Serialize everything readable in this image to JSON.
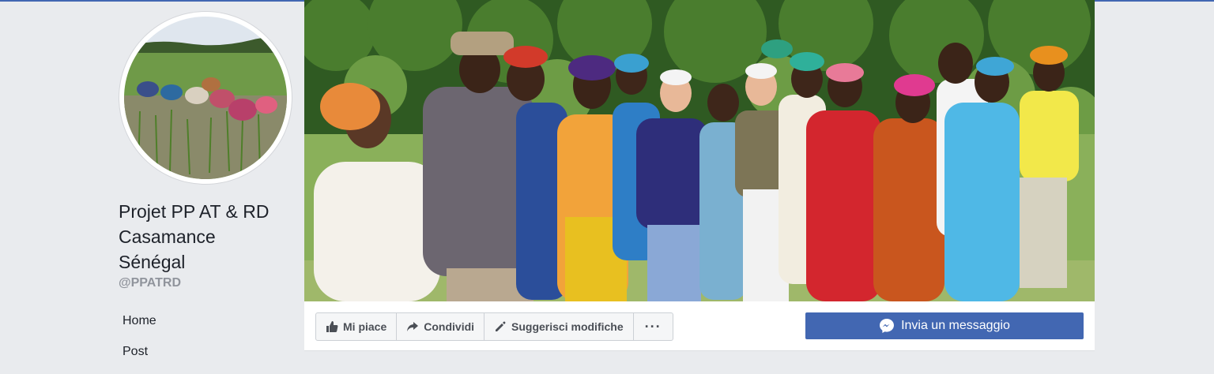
{
  "page": {
    "name_lines": [
      "Projet PP AT & RD",
      "Casamance",
      "Sénégal"
    ],
    "username": "@PPATRD"
  },
  "nav": {
    "items": [
      "Home",
      "Post"
    ]
  },
  "actions": {
    "like": "Mi piace",
    "share": "Condividi",
    "suggest": "Suggerisci modifiche",
    "more": "···"
  },
  "message_button": {
    "label": "Invia un messaggio"
  },
  "colors": {
    "brand": "#4267b2",
    "background": "#e9ebee"
  }
}
